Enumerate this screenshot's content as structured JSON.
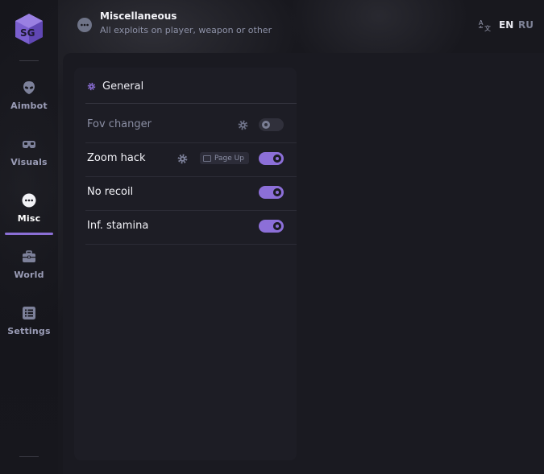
{
  "colors": {
    "accent": "#8c6fd8",
    "background": "#16161c",
    "panel": "#1d1d25"
  },
  "header": {
    "icon": "more-dots-icon",
    "title": "Miscellaneous",
    "subtitle": "All exploits on player, weapon or other",
    "languages": {
      "active": "EN",
      "inactive": "RU",
      "icon": "translate-icon"
    }
  },
  "sidebar": {
    "logo": "sg-cube-logo",
    "items": [
      {
        "label": "Aimbot",
        "icon": "alien-head-icon",
        "active": false
      },
      {
        "label": "Visuals",
        "icon": "vr-goggles-icon",
        "active": false
      },
      {
        "label": "Misc",
        "icon": "more-dots-icon",
        "active": true
      },
      {
        "label": "World",
        "icon": "briefcase-icon",
        "active": false
      },
      {
        "label": "Settings",
        "icon": "list-icon",
        "active": false
      }
    ]
  },
  "panel": {
    "title": "General",
    "title_icon": "gear-icon",
    "options": [
      {
        "name": "Fov changer",
        "enabled": false,
        "has_settings": true,
        "keybind": null
      },
      {
        "name": "Zoom hack",
        "enabled": true,
        "has_settings": true,
        "keybind": "Page Up"
      },
      {
        "name": "No recoil",
        "enabled": true,
        "has_settings": false,
        "keybind": null
      },
      {
        "name": "Inf. stamina",
        "enabled": true,
        "has_settings": false,
        "keybind": null
      }
    ]
  }
}
